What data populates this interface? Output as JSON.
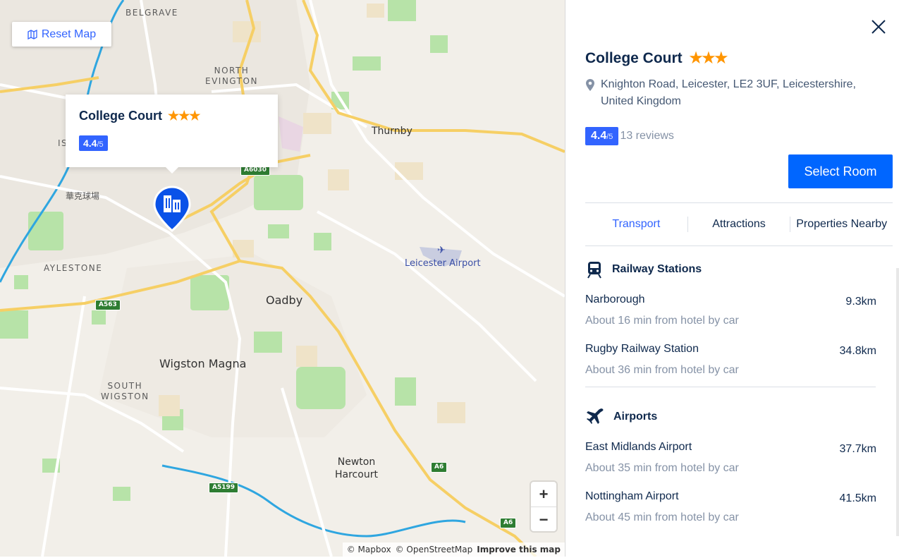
{
  "map": {
    "reset_label": "Reset Map",
    "labels": {
      "belgrave": "BELGRAVE",
      "north_evington": "NORTH\nEVINGTON",
      "thurnby": "Thurnby",
      "is": "IS",
      "chinese": "華克球場",
      "aylestone": "AYLESTONE",
      "leicester_airport": "Leicester Airport",
      "oadby": "Oadby",
      "wigston_magna": "Wigston Magna",
      "south_wigston": "SOUTH\nWIGSTON",
      "newton_harcourt": "Newton\nHarcourt"
    },
    "roads": {
      "a6030": "A6030",
      "a563": "A563",
      "a5199": "A5199",
      "a6_1": "A6",
      "a6_2": "A6"
    },
    "popup": {
      "title": "College Court",
      "stars": "★★★",
      "score": "4.4",
      "score_den": "/5"
    },
    "zoom_in": "+",
    "zoom_out": "−",
    "attribution": {
      "mapbox": "© Mapbox",
      "osm": "© OpenStreetMap",
      "improve": "Improve this map"
    },
    "colors": {
      "land": "#f2efe9",
      "park": "#b7e3a8",
      "water": "#2fa6e0",
      "major_road": "#f6cf65",
      "road": "#ffffff"
    }
  },
  "hotel": {
    "title": "College Court",
    "stars": "★★★",
    "address": "Knighton Road, Leicester, LE2 3UF, Leicestershire, United Kingdom",
    "score": "4.4",
    "score_den": "/5",
    "reviews": "13 reviews",
    "select_room": "Select Room"
  },
  "tabs": [
    {
      "label": "Transport",
      "active": true
    },
    {
      "label": "Attractions",
      "active": false
    },
    {
      "label": "Properties Nearby",
      "active": false
    }
  ],
  "sections": [
    {
      "title": "Railway Stations",
      "icon": "train-icon",
      "items": [
        {
          "name": "Narborough",
          "distance": "9.3km",
          "sub": "About 16 min from hotel by car"
        },
        {
          "name": "Rugby Railway Station",
          "distance": "34.8km",
          "sub": "About 36 min from hotel by car"
        }
      ]
    },
    {
      "title": "Airports",
      "icon": "airplane-icon",
      "items": [
        {
          "name": "East Midlands Airport",
          "distance": "37.7km",
          "sub": "About 35 min from hotel by car"
        },
        {
          "name": "Nottingham Airport",
          "distance": "41.5km",
          "sub": "About 45 min from hotel by car"
        }
      ]
    }
  ],
  "colors": {
    "accent": "#3264ff",
    "button": "#0066ff",
    "star": "#ff9500",
    "text": "#0f294d",
    "muted": "#8592a6"
  }
}
